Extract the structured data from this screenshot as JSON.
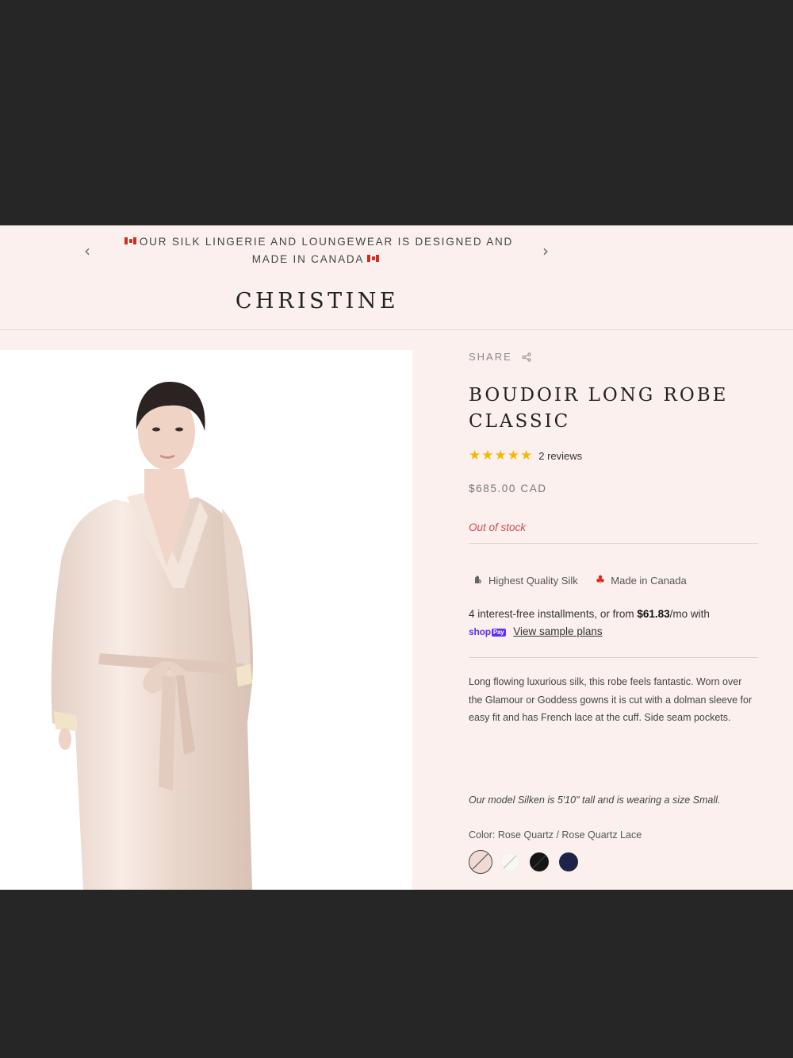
{
  "announcement": {
    "line1": "OUR SILK LINGERIE AND LOUNGEWEAR IS DESIGNED AND",
    "line2": "MADE IN CANADA",
    "prev_icon": "‹",
    "next_icon": "›"
  },
  "header": {
    "logo": "CHRISTINE"
  },
  "product": {
    "share_label": "SHARE",
    "title": "BOUDOIR LONG ROBE CLASSIC",
    "rating_stars": 5,
    "reviews": "2 reviews",
    "price": "$685.00 CAD",
    "stock_status": "Out of stock",
    "badges": [
      {
        "icon": "silk-icon",
        "label": "Highest Quality Silk"
      },
      {
        "icon": "maple-leaf-icon",
        "label": "Made in Canada"
      }
    ],
    "installments": {
      "text_before": "4 interest-free installments, or from ",
      "amount": "$61.83",
      "text_after": "/mo with",
      "shop_label": "shop",
      "pay_label": "Pay",
      "link": "View sample plans"
    },
    "description": "Long flowing luxurious silk, this robe feels fantastic. Worn over the Glamour or Goddess gowns it is cut with a dolman sleeve for easy fit and has French lace at the cuff. Side seam pockets.",
    "model_note": "Our model Silken is 5'10\" tall and is wearing a size Small.",
    "color_label": "Color: Rose Quartz / Rose Quartz Lace",
    "swatches": [
      {
        "name": "Rose Quartz",
        "color": "#f1dad4",
        "selected": true
      },
      {
        "name": "White",
        "color": "#faf7f3"
      },
      {
        "name": "Black",
        "color": "#151515"
      },
      {
        "name": "Navy",
        "color": "#1f2347"
      }
    ]
  },
  "colors": {
    "page_bg": "#fbf0ee",
    "outer_bg": "#262626",
    "stock_red": "#d04a4a",
    "star_gold": "#f5b700",
    "shop_pay_purple": "#5a31f4"
  }
}
